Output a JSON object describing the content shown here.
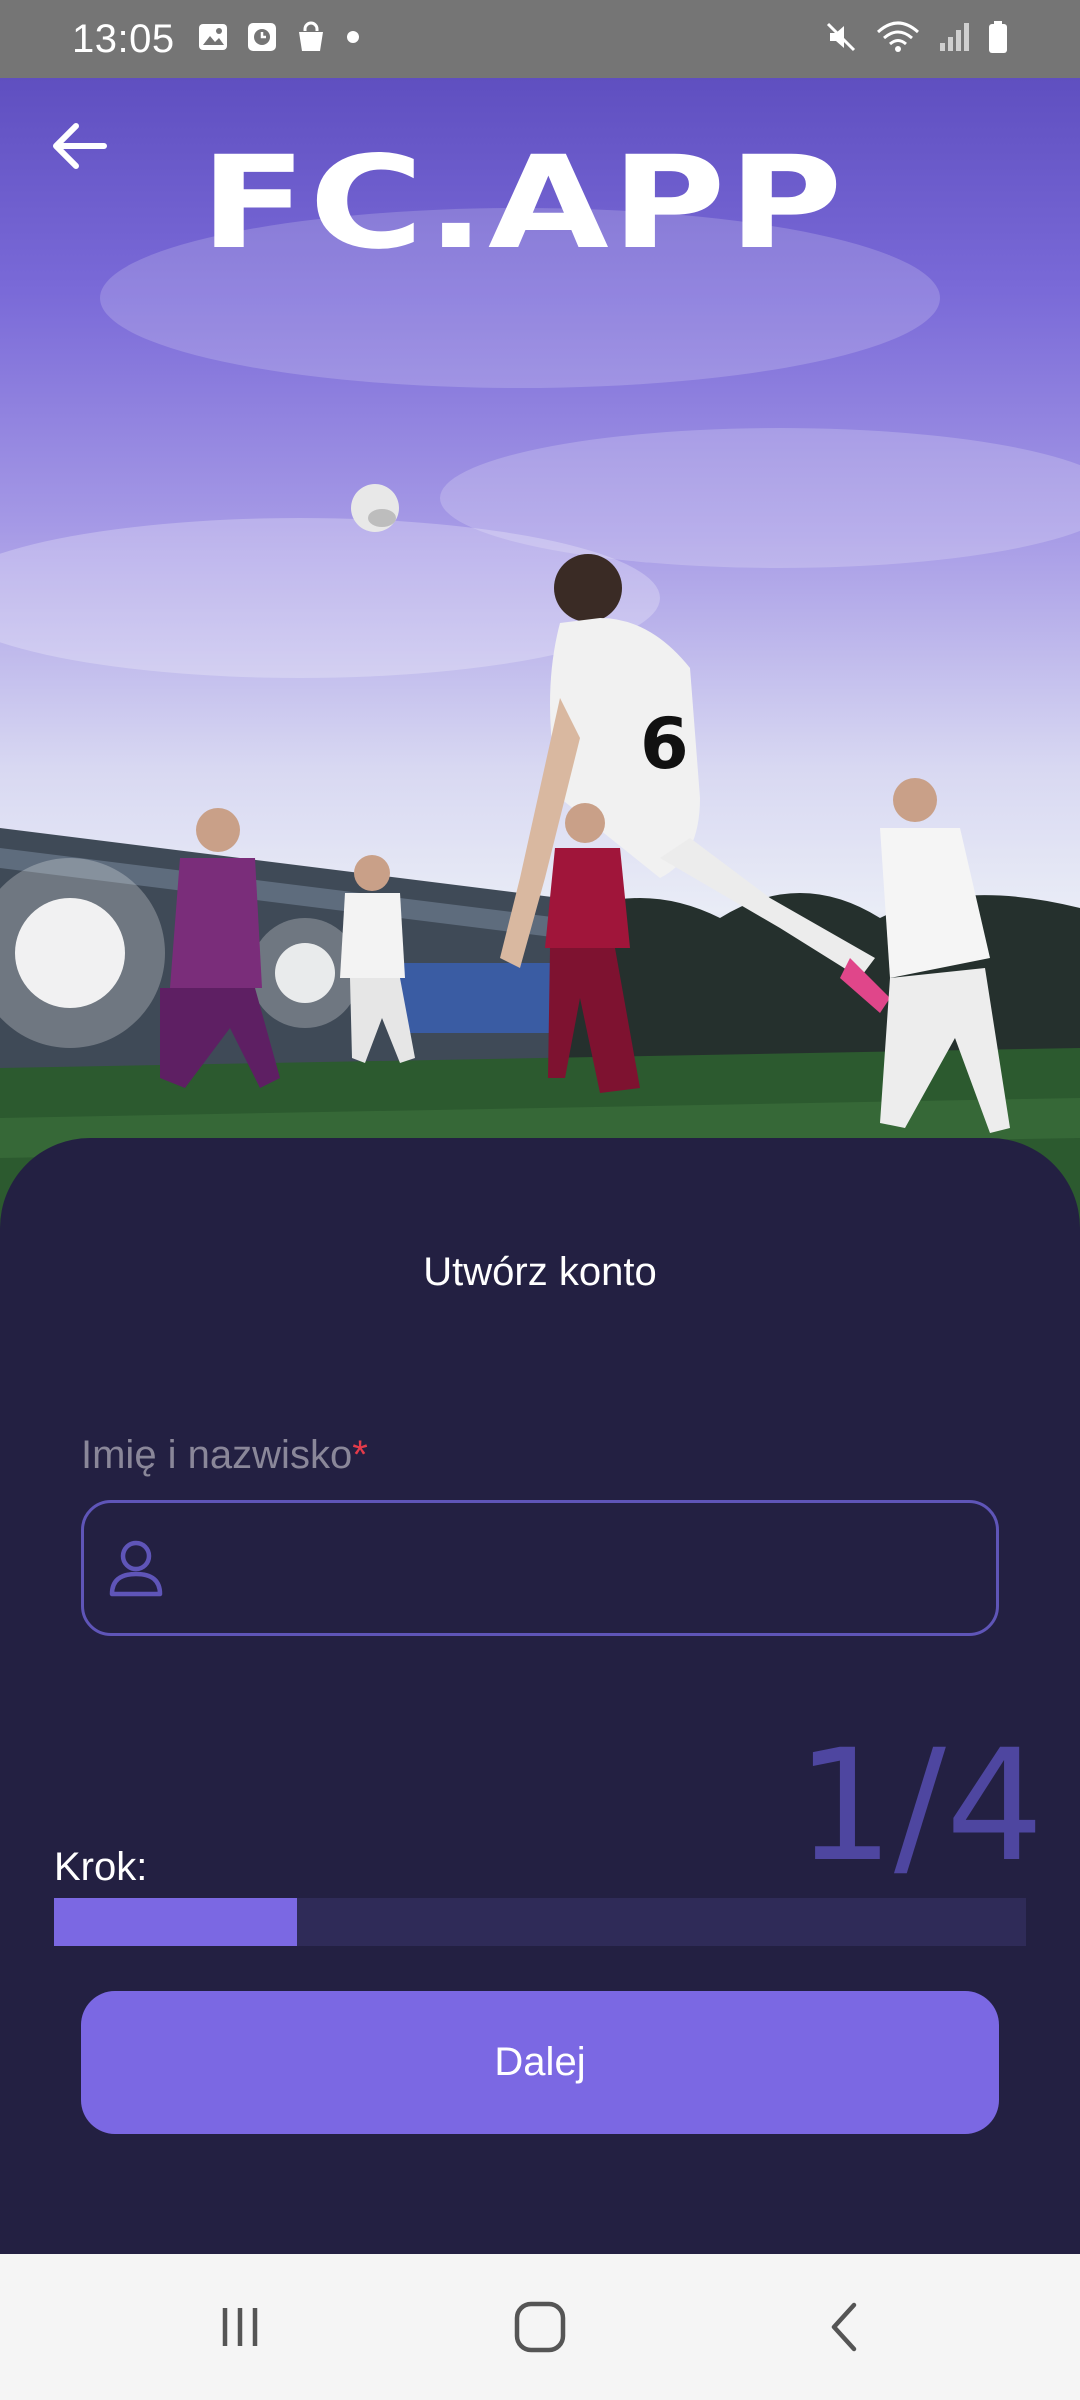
{
  "status_bar": {
    "time": "13:05",
    "left_icons": [
      "gallery-icon",
      "clock-app-icon",
      "shopping-bag-icon",
      "dot-icon"
    ],
    "right_icons": [
      "mute-icon",
      "wifi-icon",
      "signal-icon",
      "battery-icon"
    ]
  },
  "header": {
    "logo_text": "FC.APP",
    "back_icon": "arrow-left-icon"
  },
  "form": {
    "title": "Utwórz konto",
    "name_label": "Imię i nazwisko",
    "required_mark": "*",
    "name_value": "",
    "name_icon": "user-icon"
  },
  "progress": {
    "step_label": "Krok:",
    "step_text": "1/4",
    "current_step": 1,
    "total_steps": 4
  },
  "actions": {
    "next_label": "Dalej"
  },
  "navigation": {
    "items": [
      "recents-icon",
      "home-icon",
      "back-icon"
    ]
  },
  "colors": {
    "accent": "#7b68e3",
    "card_bg": "#232042",
    "required": "#e43b4a"
  }
}
